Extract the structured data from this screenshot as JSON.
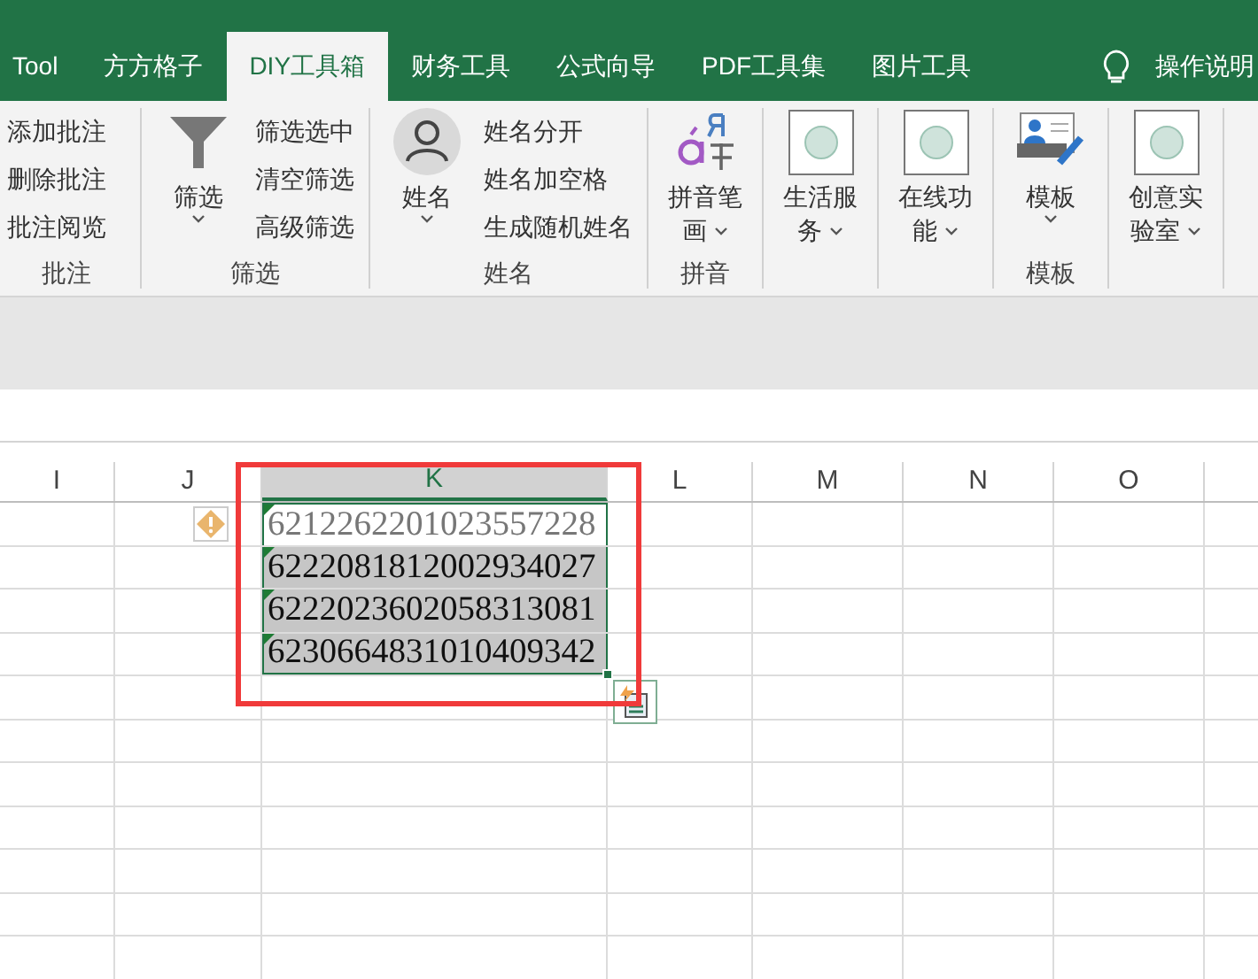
{
  "tabs": [
    {
      "label": "Tool",
      "selected": false
    },
    {
      "label": "方方格子",
      "selected": false
    },
    {
      "label": "DIY工具箱",
      "selected": true
    },
    {
      "label": "财务工具",
      "selected": false
    },
    {
      "label": "公式向导",
      "selected": false
    },
    {
      "label": "PDF工具集",
      "selected": false
    },
    {
      "label": "图片工具",
      "selected": false
    }
  ],
  "help": {
    "label": "操作说明"
  },
  "ribbon_groups": [
    {
      "label": "批注",
      "small": [
        "添加批注",
        "删除批注",
        "批注阅览"
      ]
    },
    {
      "label": "筛选",
      "button": {
        "label": "筛选"
      },
      "small": [
        "筛选选中",
        "清空筛选",
        "高级筛选"
      ]
    },
    {
      "label": "姓名",
      "button": {
        "label": "姓名"
      },
      "small": [
        "姓名分开",
        "姓名加空格",
        "生成随机姓名"
      ]
    },
    {
      "label": "拼音",
      "button": {
        "label": "拼音笔画"
      }
    },
    {
      "button": {
        "label": "生活服务"
      }
    },
    {
      "button": {
        "label": "在线功能"
      }
    },
    {
      "label": "模板",
      "button": {
        "label": "模板"
      }
    },
    {
      "button": {
        "label": "创意实验室"
      }
    }
  ],
  "columns": [
    {
      "label": "I",
      "selected": false
    },
    {
      "label": "J",
      "selected": false
    },
    {
      "label": "K",
      "selected": true
    },
    {
      "label": "L",
      "selected": false
    },
    {
      "label": "M",
      "selected": false
    },
    {
      "label": "N",
      "selected": false
    },
    {
      "label": "O",
      "selected": false
    }
  ],
  "cells": [
    {
      "value": "6212262201023557228",
      "active": true,
      "warning": true
    },
    {
      "value": "6222081812002934027",
      "active": false,
      "warning": false
    },
    {
      "value": "6222023602058313081",
      "active": false,
      "warning": false
    },
    {
      "value": "6230664831010409342",
      "active": false,
      "warning": false
    }
  ]
}
